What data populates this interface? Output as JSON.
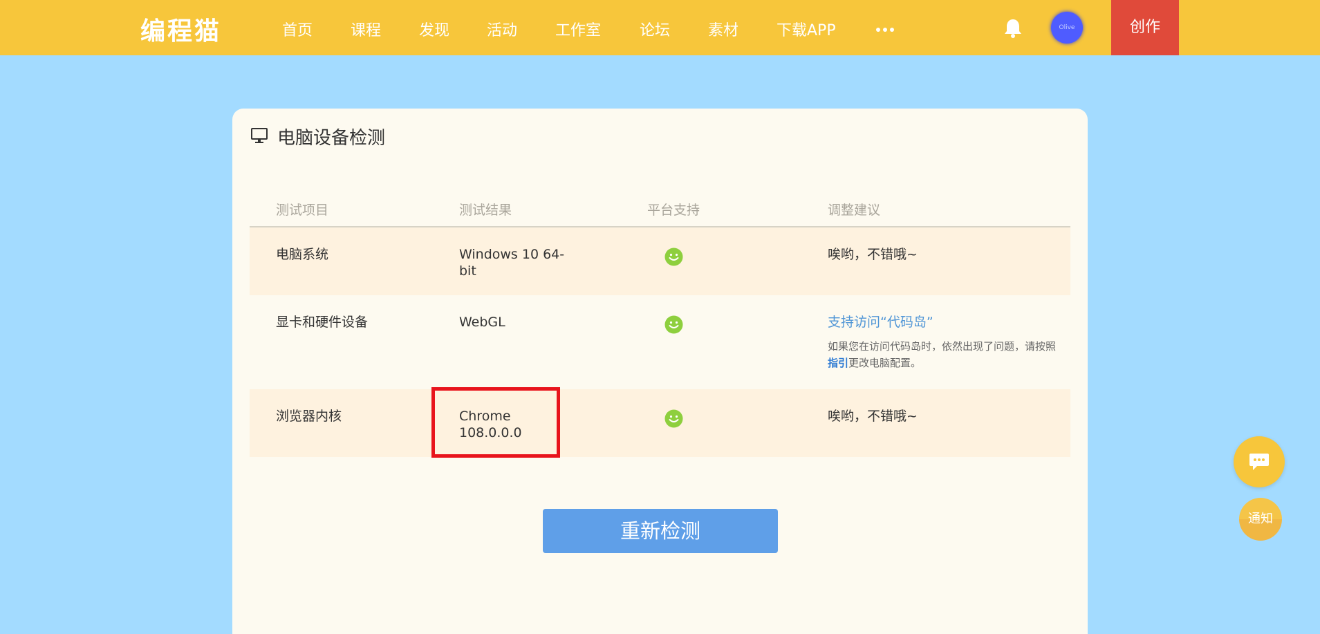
{
  "brand": {
    "logo_text": "编程猫"
  },
  "nav": {
    "items": [
      "首页",
      "课程",
      "发现",
      "活动",
      "工作室",
      "论坛",
      "素材",
      "下载APP"
    ],
    "more_icon": "ellipsis-icon",
    "bell_icon": "bell-icon",
    "avatar_text": "Olive",
    "create_label": "创作"
  },
  "card": {
    "title": "电脑设备检测",
    "title_icon": "monitor-icon"
  },
  "table": {
    "headers": [
      "测试项目",
      "测试结果",
      "平台支持",
      "调整建议"
    ],
    "rows": [
      {
        "item": "电脑系统",
        "result": "Windows 10 64-bit",
        "support_icon": "smile-icon",
        "advice": "唉哟，不错哦~"
      },
      {
        "item": "显卡和硬件设备",
        "result": "WebGL",
        "support_icon": "smile-icon",
        "advice_link": "支持访问“代码岛”",
        "advice_note_before": "如果您在访问代码岛时，依然出现了问题，请按照",
        "advice_note_link": "指引",
        "advice_note_after": "更改电脑配置。"
      },
      {
        "item": "浏览器内核",
        "result": "Chrome 108.0.0.0",
        "support_icon": "smile-icon",
        "advice": "唉哟，不错哦~"
      }
    ]
  },
  "retest_label": "重新检测",
  "floating": {
    "chat_icon": "chat-bubble-icon",
    "notify_label": "通知"
  },
  "colors": {
    "nav_bg": "#f7c63b",
    "page_bg": "#a3dbff",
    "create_bg": "#e04a3a",
    "button_blue": "#5f9fe8",
    "highlight_red": "#e8141c",
    "smile_green": "#8ecf3e"
  }
}
